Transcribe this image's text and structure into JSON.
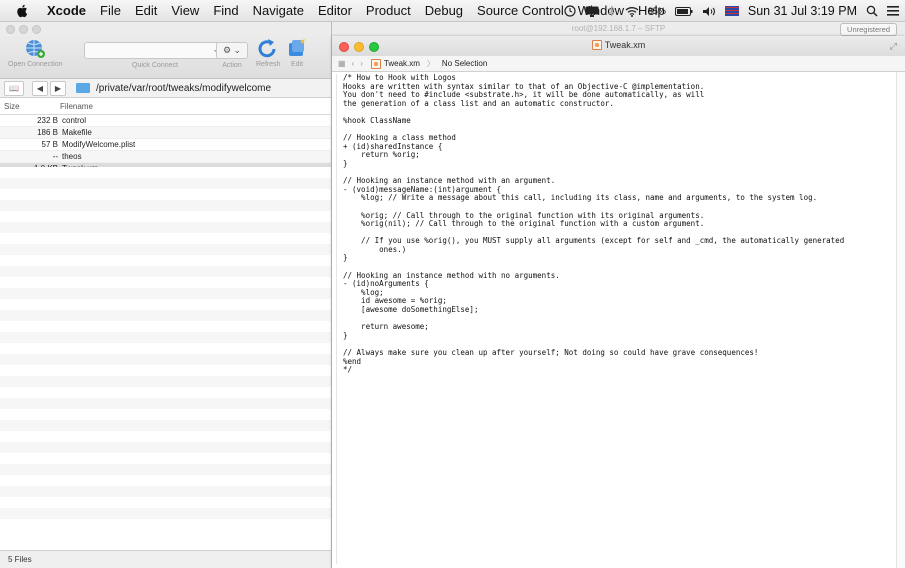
{
  "menubar": {
    "app": "Xcode",
    "items": [
      "File",
      "Edit",
      "View",
      "Find",
      "Navigate",
      "Editor",
      "Product",
      "Debug",
      "Source Control",
      "Window",
      "Help"
    ],
    "battery": "85%",
    "datetime": "Sun 31 Jul  3:19 PM"
  },
  "ftp": {
    "title": "root@192.168.1.7 – SFTP",
    "unregistered": "Unregistered",
    "toolbar": {
      "open_connection": "Open Connection",
      "quick_connect": "Quick Connect",
      "action": "Action",
      "refresh": "Refresh",
      "edit": "Edit"
    },
    "path": "/private/var/root/tweaks/modifywelcome",
    "columns": {
      "size": "Size",
      "filename": "Filename"
    },
    "files": [
      {
        "size": "232 B",
        "name": "control"
      },
      {
        "size": "186 B",
        "name": "Makefile"
      },
      {
        "size": "57 B",
        "name": "ModifyWelcome.plist"
      },
      {
        "size": "--",
        "name": "theos"
      },
      {
        "size": "1.0 KB",
        "name": "Tweak.xm"
      }
    ],
    "footer": "5 Files"
  },
  "editor": {
    "title": "Tweak.xm",
    "breadcrumb_file": "Tweak.xm",
    "breadcrumb_selection": "No Selection",
    "code": "/* How to Hook with Logos\nHooks are written with syntax similar to that of an Objective-C @implementation.\nYou don't need to #include <substrate.h>, it will be done automatically, as will\nthe generation of a class list and an automatic constructor.\n\n%hook ClassName\n\n// Hooking a class method\n+ (id)sharedInstance {\n    return %orig;\n}\n\n// Hooking an instance method with an argument.\n- (void)messageName:(int)argument {\n    %log; // Write a message about this call, including its class, name and arguments, to the system log.\n\n    %orig; // Call through to the original function with its original arguments.\n    %orig(nil); // Call through to the original function with a custom argument.\n\n    // If you use %orig(), you MUST supply all arguments (except for self and _cmd, the automatically generated\n        ones.)\n}\n\n// Hooking an instance method with no arguments.\n- (id)noArguments {\n    %log;\n    id awesome = %orig;\n    [awesome doSomethingElse];\n\n    return awesome;\n}\n\n// Always make sure you clean up after yourself; Not doing so could have grave consequences!\n%end\n*/"
  }
}
